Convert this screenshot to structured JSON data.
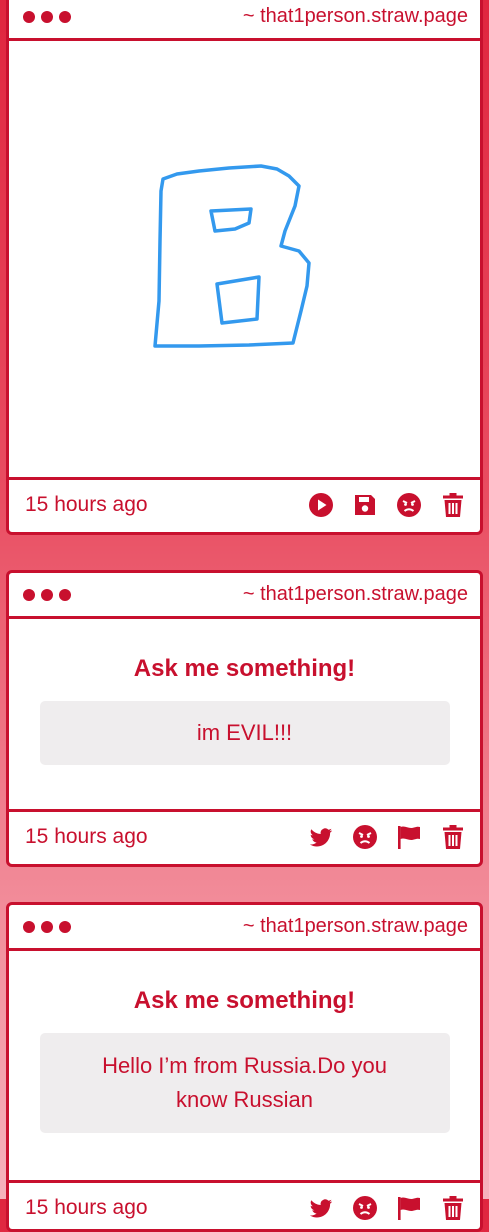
{
  "cards": [
    {
      "site": "~ that1person.straw.page",
      "time": "15 hours ago",
      "drawing_letter": "B",
      "drawing_color": "#3399ee",
      "actions": [
        "play-icon",
        "save-icon",
        "angry-face-icon",
        "trash-icon"
      ]
    },
    {
      "site": "~ that1person.straw.page",
      "heading": "Ask me something!",
      "answer": "im EVIL!!!",
      "time": "15 hours ago",
      "actions": [
        "twitter-icon",
        "angry-face-icon",
        "flag-icon",
        "trash-icon"
      ]
    },
    {
      "site": "~ that1person.straw.page",
      "heading": "Ask me something!",
      "answer": "Hello I’m from Russia.Do you know Russian",
      "time": "15 hours ago",
      "actions": [
        "twitter-icon",
        "angry-face-icon",
        "flag-icon",
        "trash-icon"
      ]
    }
  ],
  "colors": {
    "accent": "#c8102e",
    "answer_bg": "#efedee",
    "drawing": "#3399ee"
  }
}
